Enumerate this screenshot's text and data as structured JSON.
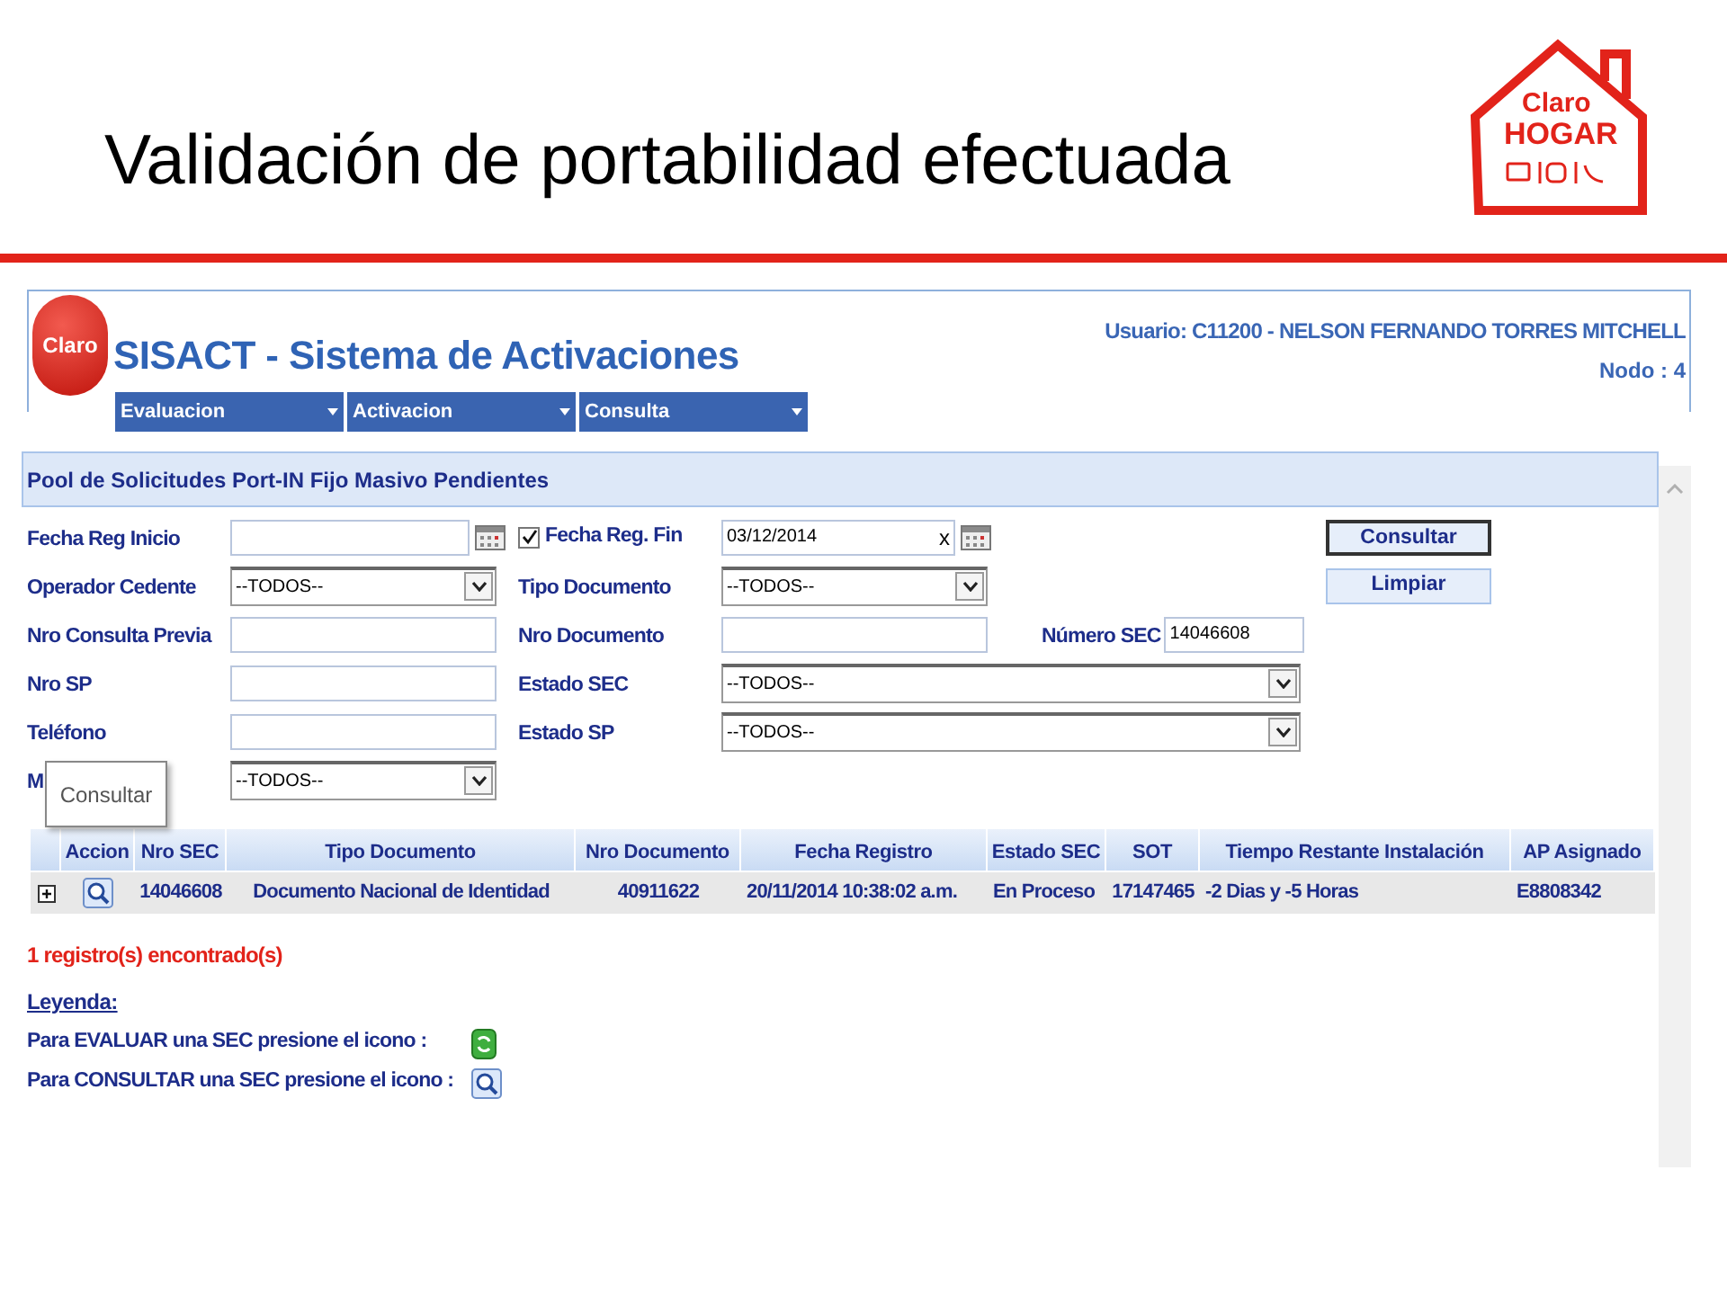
{
  "slide": {
    "title": "Validación de portabilidad efectuada"
  },
  "logo": {
    "brand": "Claro",
    "product": "HOGAR"
  },
  "app": {
    "logo_text": "Claro",
    "title": "SISACT - Sistema de Activaciones",
    "user": "Usuario: C11200 - NELSON FERNANDO TORRES MITCHELL",
    "node": "Nodo : 4",
    "menu": [
      {
        "label": "Evaluacion"
      },
      {
        "label": "Activacion"
      },
      {
        "label": "Consulta"
      }
    ],
    "panel_title": "Pool de Solicitudes Port-IN Fijo Masivo Pendientes"
  },
  "form": {
    "rows": [
      {
        "fields": [
          {
            "kind": "date",
            "label": "Fecha Reg Inicio"
          },
          {
            "kind": "checkdate",
            "label": "Fecha Reg. Fin",
            "checked": true,
            "value": "03/12/2014",
            "clear": "x"
          }
        ],
        "button": "Consultar"
      },
      {
        "fields": [
          {
            "kind": "select",
            "label": "Operador Cedente",
            "value": "--TODOS--"
          },
          {
            "kind": "select",
            "label": "Tipo Documento",
            "value": "--TODOS--"
          }
        ],
        "button": "Limpiar"
      },
      {
        "fields": [
          {
            "kind": "text",
            "label": "Nro Consulta Previa"
          },
          {
            "kind": "text",
            "label": "Nro Documento"
          },
          {
            "kind": "text",
            "label": "Número SEC",
            "value": "14046608"
          }
        ]
      },
      {
        "fields": [
          {
            "kind": "text",
            "label": "Nro SP"
          },
          {
            "kind": "wideselect",
            "label": "Estado SEC",
            "value": "--TODOS--"
          }
        ]
      },
      {
        "fields": [
          {
            "kind": "text",
            "label": "Teléfono"
          },
          {
            "kind": "wideselect",
            "label": "Estado SP",
            "value": "--TODOS--"
          }
        ]
      },
      {
        "fields": [
          {
            "kind": "select",
            "label": "M",
            "value": "--TODOS--"
          }
        ]
      }
    ]
  },
  "tooltip": "Consultar",
  "table": {
    "columns": [
      "",
      "Accion",
      "Nro SEC",
      "Tipo Documento",
      "Nro Documento",
      "Fecha Registro",
      "Estado SEC",
      "SOT",
      "Tiempo Restante Instalación",
      "AP Asignado"
    ],
    "rows": [
      {
        "cells": [
          "",
          "",
          "14046608",
          "Documento Nacional de Identidad",
          "40911622",
          "20/11/2014 10:38:02 a.m.",
          "En Proceso",
          "17147465",
          "-2 Dias y -5 Horas",
          "E8808342"
        ]
      }
    ]
  },
  "result_count": "1 registro(s) encontrado(s)",
  "legend": {
    "title": "Leyenda:",
    "items": [
      {
        "kind": "evaluate",
        "text": "Para EVALUAR una SEC presione el icono :"
      },
      {
        "kind": "consult",
        "text": "Para CONSULTAR una SEC presione el icono :"
      }
    ]
  }
}
